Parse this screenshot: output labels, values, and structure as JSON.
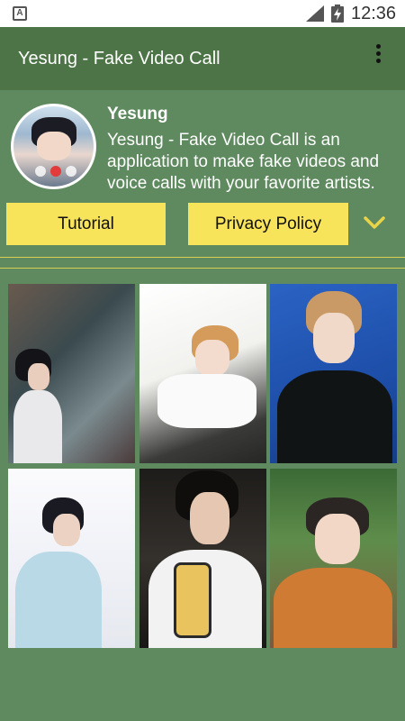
{
  "status_bar": {
    "time": "12:36",
    "app_icon_letter": "A",
    "icons": [
      "app-notification-icon",
      "signal-icon",
      "battery-charging-icon"
    ]
  },
  "app_bar": {
    "title": "Yesung - Fake Video Call",
    "menu_icon": "overflow-menu-icon"
  },
  "artist": {
    "name": "Yesung",
    "description": "Yesung - Fake Video Call is an application to make fake videos and voice calls with your favorite artists."
  },
  "buttons": {
    "tutorial": "Tutorial",
    "privacy": "Privacy Policy",
    "expand_icon": "chevron-down-icon"
  },
  "photos": [
    {
      "name": "photo-1",
      "description_icon": "artist-photo"
    },
    {
      "name": "photo-2",
      "description_icon": "artist-photo"
    },
    {
      "name": "photo-3",
      "description_icon": "artist-photo"
    },
    {
      "name": "photo-4",
      "description_icon": "artist-photo"
    },
    {
      "name": "photo-5",
      "description_icon": "artist-photo"
    },
    {
      "name": "photo-6",
      "description_icon": "artist-photo"
    }
  ],
  "colors": {
    "background": "#5f8a5f",
    "app_bar": "#4c7446",
    "button": "#f8e45a",
    "accent": "#e8d44a",
    "divider": "#d8cf55"
  }
}
